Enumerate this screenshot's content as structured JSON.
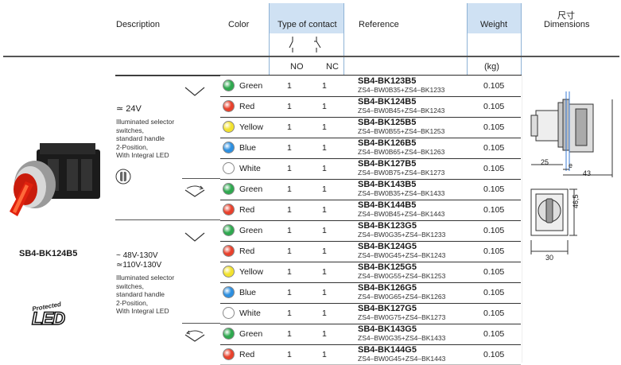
{
  "header": {
    "description": "Description",
    "color": "Color",
    "type_of_contact": "Type of contact",
    "reference": "Reference",
    "weight": "Weight",
    "dimensions_cn": "尺寸",
    "dimensions": "Dimensions",
    "no": "NO",
    "nc": "NC",
    "kg": "(kg)"
  },
  "product": {
    "model": "SB4-BK124B5",
    "logo_line1": "Protected",
    "logo_line2": "LED"
  },
  "groups": [
    {
      "voltage1": "≃ 24V",
      "voltage2": "",
      "text": [
        "Illuminated selector",
        "switches,",
        "standard handle",
        "2-Position,",
        "With Integral LED"
      ]
    },
    {
      "voltage1": "~ 48V-130V",
      "voltage2": "≃110V-130V",
      "text": [
        "Illuminated selector",
        "switches,",
        "standard handle",
        "2-Position,",
        "With Integral LED"
      ]
    }
  ],
  "rows": [
    {
      "color": "Green",
      "hex": "#2fa84f",
      "no": "1",
      "nc": "1",
      "ref": "SB4-BK123B5",
      "sub": "ZS4–BW0B35+ZS4–BK1233",
      "weight": "0.105"
    },
    {
      "color": "Red",
      "hex": "#e8412c",
      "no": "1",
      "nc": "1",
      "ref": "SB4-BK124B5",
      "sub": "ZS4–BW0B45+ZS4–BK1243",
      "weight": "0.105"
    },
    {
      "color": "Yellow",
      "hex": "#f2e22e",
      "no": "1",
      "nc": "1",
      "ref": "SB4-BK125B5",
      "sub": "ZS4–BW0B55+ZS4–BK1253",
      "weight": "0.105"
    },
    {
      "color": "Blue",
      "hex": "#2d8fe0",
      "no": "1",
      "nc": "1",
      "ref": "SB4-BK126B5",
      "sub": "ZS4–BW0B65+ZS4–BK1263",
      "weight": "0.105"
    },
    {
      "color": "White",
      "hex": "#ffffff",
      "no": "1",
      "nc": "1",
      "ref": "SB4-BK127B5",
      "sub": "ZS4–BW0B75+ZS4–BK1273",
      "weight": "0.105"
    },
    {
      "color": "Green",
      "hex": "#2fa84f",
      "no": "1",
      "nc": "1",
      "ref": "SB4-BK143B5",
      "sub": "ZS4–BW0B35+ZS4–BK1433",
      "weight": "0.105"
    },
    {
      "color": "Red",
      "hex": "#e8412c",
      "no": "1",
      "nc": "1",
      "ref": "SB4-BK144B5",
      "sub": "ZS4–BW0B45+ZS4–BK1443",
      "weight": "0.105"
    },
    {
      "color": "Green",
      "hex": "#2fa84f",
      "no": "1",
      "nc": "1",
      "ref": "SB4-BK123G5",
      "sub": "ZS4–BW0G35+ZS4–BK1233",
      "weight": "0.105"
    },
    {
      "color": "Red",
      "hex": "#e8412c",
      "no": "1",
      "nc": "1",
      "ref": "SB4-BK124G5",
      "sub": "ZS4–BW0G45+ZS4–BK1243",
      "weight": "0.105"
    },
    {
      "color": "Yellow",
      "hex": "#f2e22e",
      "no": "1",
      "nc": "1",
      "ref": "SB4-BK125G5",
      "sub": "ZS4–BW0G55+ZS4–BK1253",
      "weight": "0.105"
    },
    {
      "color": "Blue",
      "hex": "#2d8fe0",
      "no": "1",
      "nc": "1",
      "ref": "SB4-BK126G5",
      "sub": "ZS4–BW0G65+ZS4–BK1263",
      "weight": "0.105"
    },
    {
      "color": "White",
      "hex": "#ffffff",
      "no": "1",
      "nc": "1",
      "ref": "SB4-BK127G5",
      "sub": "ZS4–BW0G75+ZS4–BK1273",
      "weight": "0.105"
    },
    {
      "color": "Green",
      "hex": "#2fa84f",
      "no": "1",
      "nc": "1",
      "ref": "SB4-BK143G5",
      "sub": "ZS4–BW0G35+ZS4–BK1433",
      "weight": "0.105"
    },
    {
      "color": "Red",
      "hex": "#e8412c",
      "no": "1",
      "nc": "1",
      "ref": "SB4-BK144G5",
      "sub": "ZS4–BW0G45+ZS4–BK1443",
      "weight": "0.105"
    }
  ],
  "dimensions": {
    "d25": "25",
    "de": "e",
    "d43": "43",
    "d46_5": "46,5",
    "d30": "30"
  }
}
